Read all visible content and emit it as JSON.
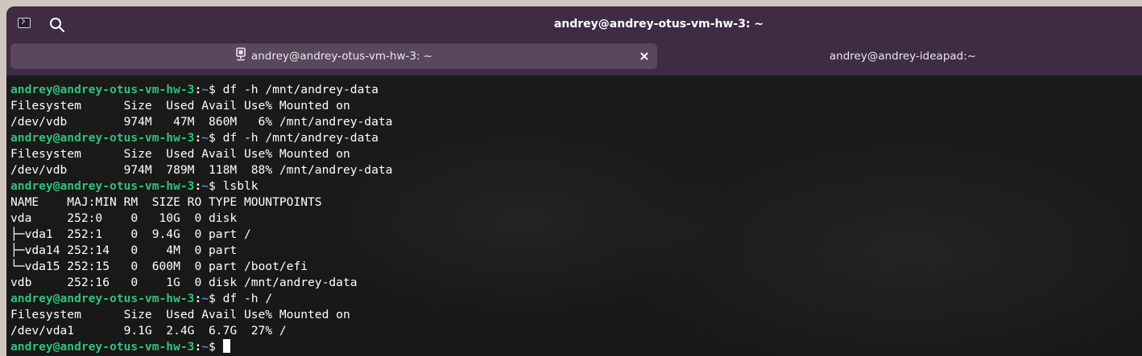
{
  "window": {
    "title": "andrey@andrey-otus-vm-hw-3: ~"
  },
  "icons": {
    "terminal": "terminal-icon",
    "search": "search-icon",
    "remote": "remote-session-icon",
    "close": "close-icon"
  },
  "tabs": [
    {
      "label": "andrey@andrey-otus-vm-hw-3: ~",
      "active": true,
      "close": "×"
    },
    {
      "label": "andrey@andrey-ideapad:~",
      "active": false
    }
  ],
  "colors": {
    "prompt_user": "#2ec27e",
    "prompt_dir": "#5290e0",
    "header_bg": "#3f2b44",
    "active_tab_bg": "#5a475e",
    "terminal_bg": "#181818"
  },
  "prompt": {
    "user_host": "andrey@andrey-otus-vm-hw-3",
    "sep": ":",
    "dir": "~",
    "symbol": "$"
  },
  "lines": [
    {
      "type": "prompt",
      "cmd": " df -h /mnt/andrey-data"
    },
    {
      "type": "output",
      "text": "Filesystem      Size  Used Avail Use% Mounted on"
    },
    {
      "type": "output",
      "text": "/dev/vdb        974M   47M  860M   6% /mnt/andrey-data"
    },
    {
      "type": "prompt",
      "cmd": " df -h /mnt/andrey-data"
    },
    {
      "type": "output",
      "text": "Filesystem      Size  Used Avail Use% Mounted on"
    },
    {
      "type": "output",
      "text": "/dev/vdb        974M  789M  118M  88% /mnt/andrey-data"
    },
    {
      "type": "prompt",
      "cmd": " lsblk"
    },
    {
      "type": "output",
      "text": "NAME    MAJ:MIN RM  SIZE RO TYPE MOUNTPOINTS"
    },
    {
      "type": "output",
      "text": "vda     252:0    0   10G  0 disk"
    },
    {
      "type": "output",
      "text": "├─vda1  252:1    0  9.4G  0 part /"
    },
    {
      "type": "output",
      "text": "├─vda14 252:14   0    4M  0 part"
    },
    {
      "type": "output",
      "text": "└─vda15 252:15   0  600M  0 part /boot/efi"
    },
    {
      "type": "output",
      "text": "vdb     252:16   0    1G  0 disk /mnt/andrey-data"
    },
    {
      "type": "prompt",
      "cmd": " df -h /"
    },
    {
      "type": "output",
      "text": "Filesystem      Size  Used Avail Use% Mounted on"
    },
    {
      "type": "output",
      "text": "/dev/vda1       9.1G  2.4G  6.7G  27% /"
    },
    {
      "type": "prompt",
      "cmd": "",
      "cursor": true
    }
  ]
}
